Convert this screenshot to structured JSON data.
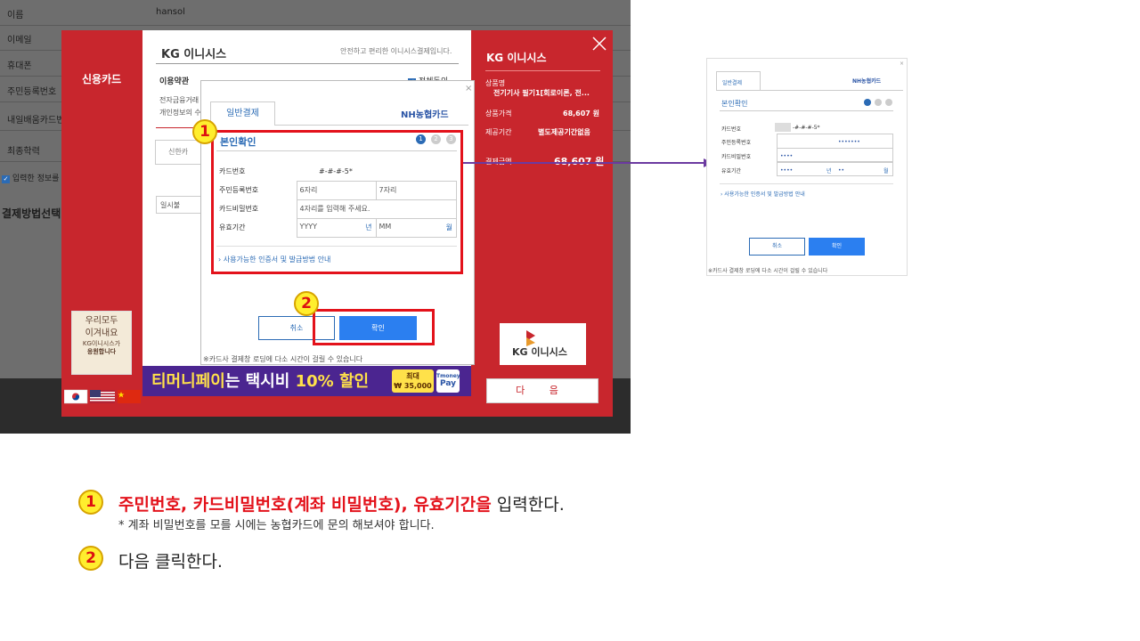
{
  "bg_form": {
    "rows": [
      {
        "label": "이름",
        "value": "hansol"
      },
      {
        "label": "이메일",
        "value": ""
      },
      {
        "label": "휴대폰",
        "value": ""
      },
      {
        "label": "주민등록번호",
        "value": ""
      },
      {
        "label": "내일배움카드번",
        "value": ""
      },
      {
        "label": "최종학력",
        "value": ""
      }
    ],
    "consent_label": "입력한 정보를",
    "payment_section": "결제방법선택"
  },
  "inicis": {
    "left_tab": "신용카드",
    "brand_small": "KG 이니시스",
    "brand_tagline": "안전하고 편리한 이니시스결제입니다.",
    "terms_title": "이용약관",
    "agree_all": "전체동의",
    "terms_line1": "전자금융거래",
    "terms_line2": "개인정보의 수",
    "apply_button": "신한카",
    "installment": "일시불",
    "right_brand": "KG 이니시스",
    "product_label": "상품명",
    "product_value": "전기기사 필기1[회로이론, 전...",
    "price_label": "상품가격",
    "price_value": "68,607 원",
    "period_label": "제공기간",
    "period_value": "별도제공기간없음",
    "amount_label": "결제금액",
    "amount_value": "68,607 원",
    "logo_text": "KG 이니시스",
    "next_button": "다 음",
    "promo_line1": "우리모두",
    "promo_line2": "이겨내요",
    "promo_line3": "KG이니시스가",
    "promo_line4": "응원합니다",
    "banner_brand": "티머니페이",
    "banner_text": "는 택시비 ",
    "banner_highlight": "10% 할인",
    "banner_max": "최대",
    "banner_amount": "₩ 35,000",
    "banner_pay_line1": "Tmoney",
    "banner_pay_line2": "Pay"
  },
  "nh_dialog": {
    "tab_general": "일반결제",
    "card_brand": "NH농협카드",
    "title": "본인확인",
    "steps": [
      "1",
      "2",
      "3"
    ],
    "card_number_label": "카드번호",
    "card_number_value": "#-#-#-5*",
    "rrn_label": "주민등록번호",
    "rrn_front_placeholder": "6자리",
    "rrn_back_placeholder": "7자리",
    "pin_label": "카드비밀번호",
    "pin_placeholder": "4자리를 입력해 주세요.",
    "expiry_label": "유효기간",
    "expiry_year_placeholder": "YYYY",
    "expiry_year_unit": "년",
    "expiry_month_placeholder": "MM",
    "expiry_month_unit": "월",
    "guide_link": "› 사용가능한 인증서 및 발급방법 안내",
    "cancel": "취소",
    "ok": "확인",
    "loading_note": "※카드사 결제창 로딩에 다소 시간이 걸릴 수 있습니다"
  },
  "zoom": {
    "tab_general": "일반결제",
    "card_brand": "NH농협카드",
    "title": "본인확인",
    "card_number_label": "카드번호",
    "card_number_value": "-#-#-#-5*",
    "rrn_label": "주민등록번호",
    "rrn_value": "•••••••",
    "pin_label": "카드비밀번호",
    "pin_value": "••••",
    "expiry_label": "유효기간",
    "expiry_year": "••••",
    "expiry_year_unit": "년",
    "expiry_month": "••",
    "expiry_month_unit": "월",
    "guide_link": "› 사용가능한 인증서 및 발급방법 안내",
    "cancel": "취소",
    "ok": "확인",
    "note": "※카드사 결제창 로딩에 다소 시간이 걸릴 수 있습니다"
  },
  "badges": [
    "1",
    "2"
  ],
  "instructions": {
    "step1_red": "주민번호, 카드비밀번호(계좌 비밀번호), 유효기간을",
    "step1_rest": " 입력한다.",
    "step1_note": "* 계좌 비밀번호를 모를 시에는 농협카드에 문의 해보셔야 합니다.",
    "step2": "다음 클릭한다."
  },
  "colors": {
    "inicis_red": "#c8262d",
    "highlight_red": "#e3121b",
    "nh_blue": "#2b6bb5",
    "ok_blue": "#2b7ff0",
    "badge_yellow": "#ffee2e",
    "arrow_purple": "#6b3aa0"
  }
}
